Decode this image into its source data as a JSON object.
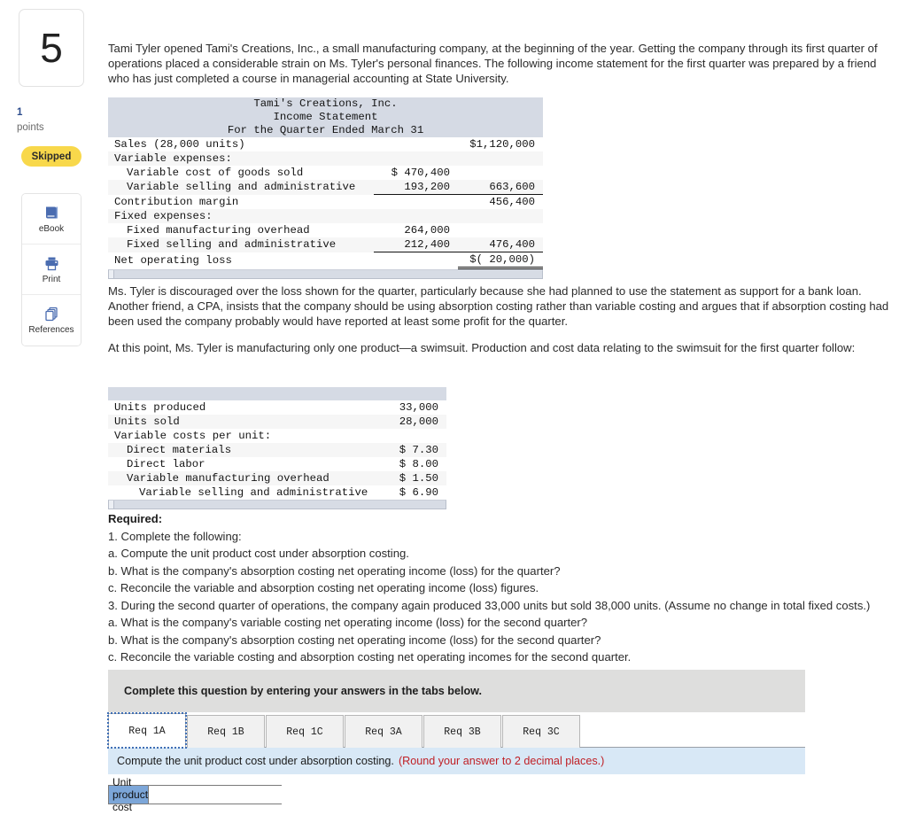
{
  "sidebar": {
    "question_number": "5",
    "points_value": "1",
    "points_label": "points",
    "status_badge": "Skipped",
    "tools": [
      {
        "icon": "ebook-icon",
        "label": "eBook"
      },
      {
        "icon": "print-icon",
        "label": "Print"
      },
      {
        "icon": "references-icon",
        "label": "References"
      }
    ]
  },
  "body": {
    "paragraph_1": "Tami Tyler opened Tami's Creations, Inc., a small manufacturing company, at the beginning of the year. Getting the company through its first quarter of operations placed a considerable strain on Ms. Tyler's personal finances. The following income statement for the first quarter was prepared by a friend who has just completed a course in managerial accounting at State University.",
    "paragraph_2": "Ms. Tyler is discouraged over the loss shown for the quarter, particularly because she had planned to use the statement as support for a bank loan. Another friend, a CPA, insists that the company should be using absorption costing rather than variable costing and argues that if absorption costing had been used the company probably would have reported at least some profit for the quarter.",
    "paragraph_3": "At this point, Ms. Tyler is manufacturing only one product—a swimsuit. Production and cost data relating to the swimsuit for the first quarter follow:"
  },
  "income_statement": {
    "header_lines": [
      "Tami's Creations, Inc.",
      "Income Statement",
      "For the Quarter Ended March 31"
    ],
    "rows": [
      {
        "label": "Sales (28,000 units)",
        "indent": 0,
        "col1": "",
        "col2": "$1,120,000",
        "u1": false,
        "u2": false,
        "dbl": false
      },
      {
        "label": "Variable expenses:",
        "indent": 0,
        "col1": "",
        "col2": "",
        "u1": false,
        "u2": false,
        "dbl": false
      },
      {
        "label": "Variable cost of goods sold",
        "indent": 1,
        "col1": "$ 470,400",
        "col2": "",
        "u1": false,
        "u2": false,
        "dbl": false
      },
      {
        "label": "Variable selling and administrative",
        "indent": 1,
        "col1": "193,200",
        "col2": "663,600",
        "u1": true,
        "u2": true,
        "dbl": false
      },
      {
        "label": "Contribution margin",
        "indent": 0,
        "col1": "",
        "col2": "456,400",
        "u1": false,
        "u2": false,
        "dbl": false
      },
      {
        "label": "Fixed expenses:",
        "indent": 0,
        "col1": "",
        "col2": "",
        "u1": false,
        "u2": false,
        "dbl": false
      },
      {
        "label": "Fixed manufacturing overhead",
        "indent": 1,
        "col1": "264,000",
        "col2": "",
        "u1": false,
        "u2": false,
        "dbl": false
      },
      {
        "label": "Fixed selling and administrative",
        "indent": 1,
        "col1": "212,400",
        "col2": "476,400",
        "u1": true,
        "u2": true,
        "dbl": false
      },
      {
        "label": "Net operating loss",
        "indent": 0,
        "col1": "",
        "col2": "$( 20,000)",
        "u1": false,
        "u2": false,
        "dbl": true
      }
    ]
  },
  "cost_data_table": {
    "rows": [
      {
        "label": "Units produced",
        "indent": 0,
        "value": "33,000"
      },
      {
        "label": "Units sold",
        "indent": 0,
        "value": "28,000"
      },
      {
        "label": "Variable costs per unit:",
        "indent": 0,
        "value": ""
      },
      {
        "label": "Direct materials",
        "indent": 1,
        "value": "$ 7.30"
      },
      {
        "label": "Direct labor",
        "indent": 1,
        "value": "$ 8.00"
      },
      {
        "label": "Variable manufacturing overhead",
        "indent": 1,
        "value": "$ 1.50"
      },
      {
        "label": "Variable selling and administrative",
        "indent": 2,
        "value": "$ 6.90"
      }
    ]
  },
  "required": {
    "title": "Required:",
    "lines": [
      "1. Complete the following:",
      "a. Compute the unit product cost under absorption costing.",
      "b. What is the company's absorption costing net operating income (loss) for the quarter?",
      "c. Reconcile the variable and absorption costing net operating income (loss) figures.",
      "3. During the second quarter of operations, the company again produced 33,000 units but sold 38,000 units. (Assume no change in total fixed costs.)",
      "a. What is the company's variable costing net operating income (loss) for the second quarter?",
      "b. What is the company's absorption costing net operating income (loss) for the second quarter?",
      "c. Reconcile the variable costing and absorption costing net operating incomes for the second quarter."
    ]
  },
  "answer_panel": {
    "banner": "Complete this question by entering your answers in the tabs below.",
    "tabs": [
      {
        "label": "Req 1A",
        "active": true
      },
      {
        "label": "Req 1B",
        "active": false
      },
      {
        "label": "Req 1C",
        "active": false
      },
      {
        "label": "Req 3A",
        "active": false
      },
      {
        "label": "Req 3B",
        "active": false
      },
      {
        "label": "Req 3C",
        "active": false
      }
    ],
    "prompt_text": "Compute the unit product cost under absorption costing.",
    "prompt_note": "(Round your answer to 2 decimal places.)",
    "answer_label": "Unit product cost",
    "answer_value": "",
    "answer_placeholder": ""
  },
  "colors": {
    "badge_yellow": "#f8d84b",
    "icon_blue": "#4a6cb0",
    "table_header": "#d5dae4",
    "prompt_blue": "#d8e8f6",
    "banner_gray": "#dededd",
    "note_red": "#c02026",
    "answer_label_blue": "#7ca6d8"
  }
}
